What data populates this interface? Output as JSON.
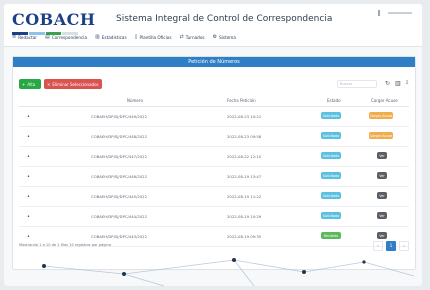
{
  "app": {
    "logo_text": "COBACH",
    "title": "Sistema Integral de Control de Correspondencia"
  },
  "nav": [
    {
      "icon": "list-icon",
      "glyph": "≡",
      "label": "Redactar"
    },
    {
      "icon": "inbox-icon",
      "glyph": "▤",
      "label": "Correspondencia"
    },
    {
      "icon": "chart-icon",
      "glyph": "▥",
      "label": "Estadísticas"
    },
    {
      "icon": "doc-icon",
      "glyph": "▯",
      "label": "Plantilla Oficios"
    },
    {
      "icon": "transfer-icon",
      "glyph": "⇄",
      "label": "Turnados"
    },
    {
      "icon": "settings-icon",
      "glyph": "⚙",
      "label": "Sistema"
    }
  ],
  "panel": {
    "title": "Petición de Números"
  },
  "toolbar": {
    "add_label": "Alta",
    "delete_label": "Eliminar Seleccionados",
    "search_placeholder": "Buscar"
  },
  "table": {
    "headers": {
      "numero": "Número",
      "fecha": "Fecha Petición",
      "estado": "Estado",
      "acuse": "Cargar Acuse"
    },
    "rows": [
      {
        "numero": "COBAEH/DP/SJ/DPC/449/2022",
        "fecha": "2022-08-23 10:21",
        "estado": "Solicitado",
        "estado_color": "#5bc0de",
        "acuse": "Cargar Acuse",
        "acuse_color": "#f0ad4e"
      },
      {
        "numero": "COBAEH/DP/SJ/DPC/448/2022",
        "fecha": "2022-08-23 09:58",
        "estado": "Solicitado",
        "estado_color": "#5bc0de",
        "acuse": "Cargar Acuse",
        "acuse_color": "#f0ad4e"
      },
      {
        "numero": "COBAEH/DP/SJ/DPC/447/2022",
        "fecha": "2022-08-22 12:10",
        "estado": "Solicitado",
        "estado_color": "#5bc0de",
        "acuse": "Ver",
        "acuse_color": "#5a5f66"
      },
      {
        "numero": "COBAEH/DP/SJ/DPC/446/2022",
        "fecha": "2022-08-19 13:47",
        "estado": "Solicitado",
        "estado_color": "#5bc0de",
        "acuse": "Ver",
        "acuse_color": "#5a5f66"
      },
      {
        "numero": "COBAEH/DP/SJ/DPC/445/2022",
        "fecha": "2022-08-19 11:22",
        "estado": "Solicitado",
        "estado_color": "#5bc0de",
        "acuse": "Ver",
        "acuse_color": "#5a5f66"
      },
      {
        "numero": "COBAEH/DP/SJ/DPC/444/2022",
        "fecha": "2022-08-19 10:29",
        "estado": "Solicitado",
        "estado_color": "#5bc0de",
        "acuse": "Ver",
        "acuse_color": "#5a5f66"
      },
      {
        "numero": "COBAEH/DP/SJ/DPC/443/2022",
        "fecha": "2022-08-19 09:35",
        "estado": "Recibido",
        "estado_color": "#5cb85c",
        "acuse": "Ver",
        "acuse_color": "#5a5f66"
      }
    ]
  },
  "footer": {
    "info": "Mostrando 1 a 10 de 1 filas   10   registros por página",
    "pages": [
      "‹",
      "1",
      "›"
    ]
  },
  "colors": {
    "header_blue": "#2f7fc7",
    "logo_blue": "#1c3f86",
    "add_green": "#28a745",
    "delete_red": "#d9534f"
  }
}
